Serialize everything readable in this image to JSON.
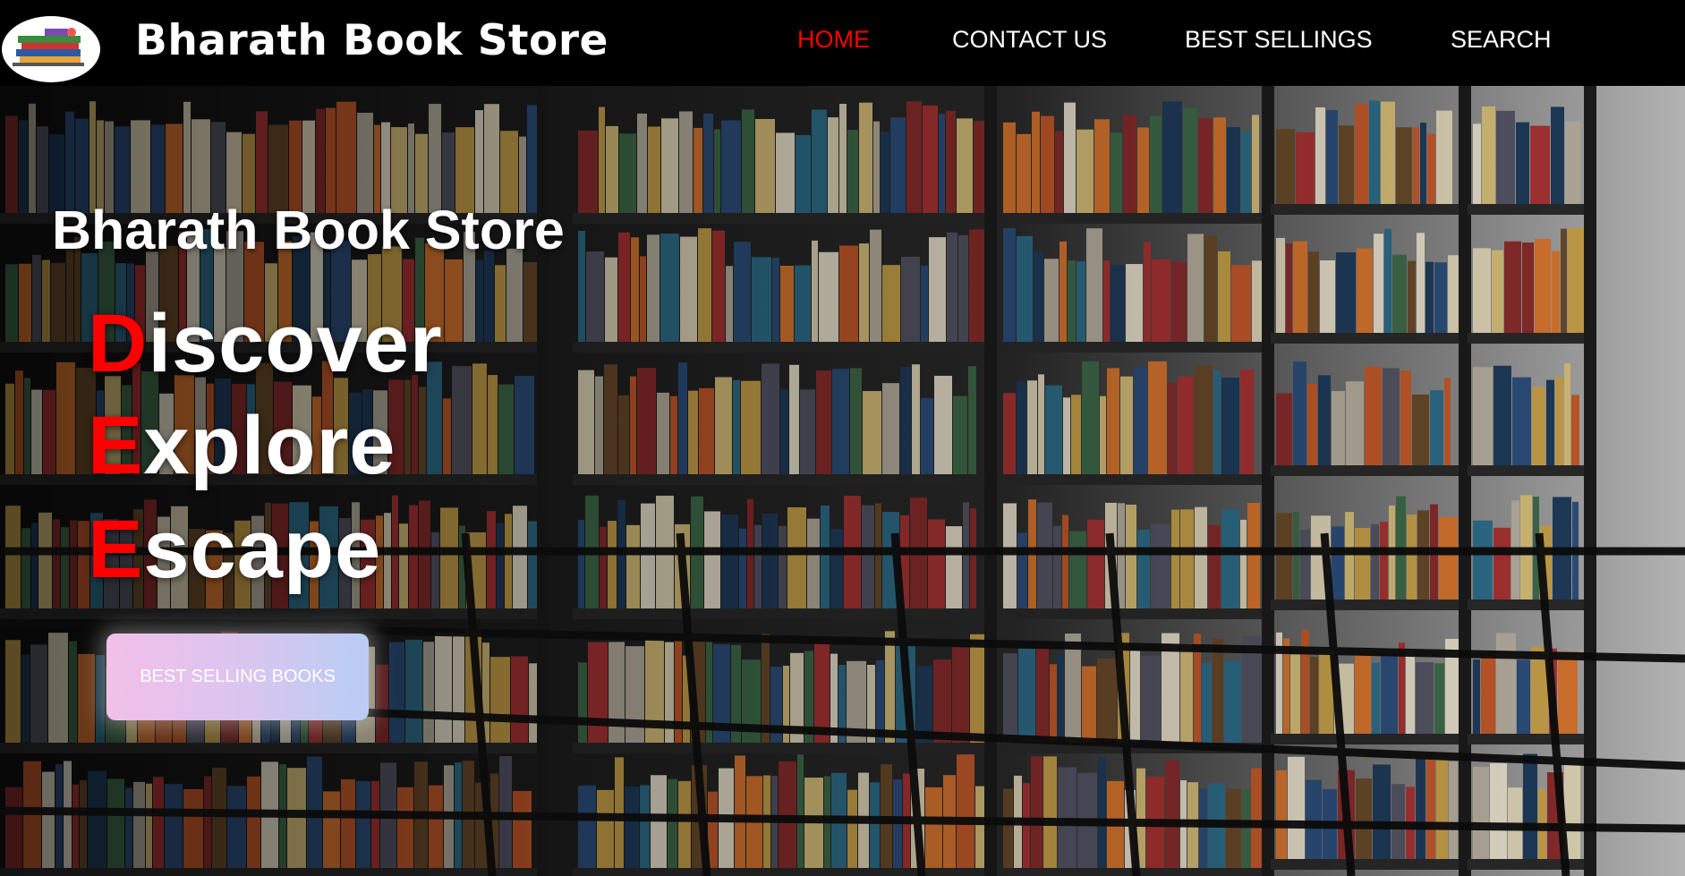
{
  "header": {
    "brand": "Bharath Book Store",
    "logo_icon": "book-stack-logo-icon",
    "nav": [
      {
        "label": "HOME",
        "active": true
      },
      {
        "label": "CONTACT US",
        "active": false
      },
      {
        "label": "BEST SELLINGS",
        "active": false
      },
      {
        "label": "SEARCH",
        "active": false
      }
    ]
  },
  "hero": {
    "title": "Bharath Book Store",
    "words": [
      {
        "first": "D",
        "rest": "iscover"
      },
      {
        "first": "E",
        "rest": "xplore"
      },
      {
        "first": "E",
        "rest": "scape"
      }
    ],
    "cta_label": "BEST SELLING BOOKS",
    "background": "library-bookshelves-photo"
  },
  "colors": {
    "header_bg": "#000000",
    "accent_red": "#ff0000",
    "text": "#ffffff",
    "cta_gradient_start": "#f2bfe8",
    "cta_gradient_end": "#b9cdf4"
  }
}
